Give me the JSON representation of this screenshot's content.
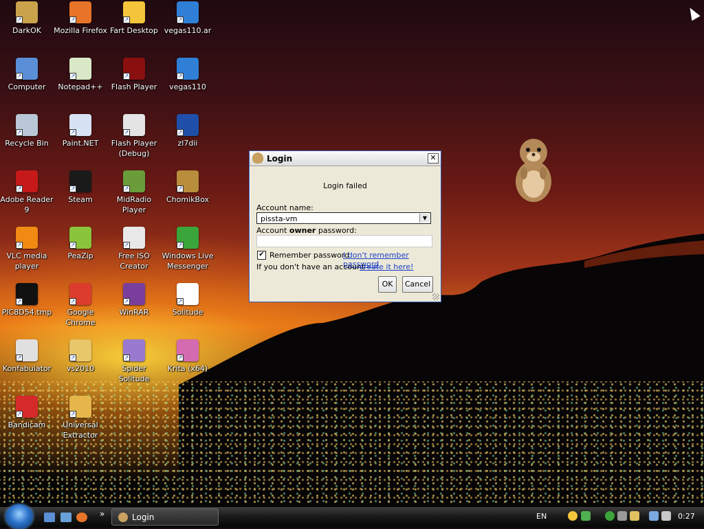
{
  "desktop": {
    "icons": [
      {
        "label": "DarkOK",
        "icon": "folder-zip-icon",
        "color": "#c9a24b"
      },
      {
        "label": "Mozilla Firefox",
        "icon": "firefox-icon",
        "color": "#e8742a"
      },
      {
        "label": "Fart Desktop",
        "icon": "smiley-icon",
        "color": "#f3c53a"
      },
      {
        "label": "vegas110.ar",
        "icon": "globe-icon",
        "color": "#2f7fd6"
      },
      {
        "label": "Computer",
        "icon": "computer-icon",
        "color": "#5a8fd8"
      },
      {
        "label": "Notepad++",
        "icon": "notepad-icon",
        "color": "#d9e8c7"
      },
      {
        "label": "Flash Player",
        "icon": "flash-icon",
        "color": "#8a1010"
      },
      {
        "label": "vegas110",
        "icon": "globe-icon",
        "color": "#2f7fd6"
      },
      {
        "label": "Recycle Bin",
        "icon": "recycle-bin-icon",
        "color": "#b9c7d6"
      },
      {
        "label": "Paint.NET",
        "icon": "paint-icon",
        "color": "#d7e3f5"
      },
      {
        "label": "Flash Player (Debug)",
        "icon": "flash-debug-icon",
        "color": "#e4e4e4"
      },
      {
        "label": "zl7dii",
        "icon": "flash-file-icon",
        "color": "#1f4fa8"
      },
      {
        "label": "Adobe Reader 9",
        "icon": "pdf-icon",
        "color": "#c61a1a"
      },
      {
        "label": "Steam",
        "icon": "steam-icon",
        "color": "#1a1a1a"
      },
      {
        "label": "MidRadio Player",
        "icon": "radio-icon",
        "color": "#6a9d3a"
      },
      {
        "label": "ChomikBox",
        "icon": "hamster-box-icon",
        "color": "#b88d3c"
      },
      {
        "label": "VLC media player",
        "icon": "vlc-cone-icon",
        "color": "#f08a12"
      },
      {
        "label": "PeaZip",
        "icon": "peazip-icon",
        "color": "#8ac43a"
      },
      {
        "label": "Free ISO Creator",
        "icon": "iso-icon",
        "color": "#e8e8e8"
      },
      {
        "label": "Windows Live Messenger",
        "icon": "messenger-icon",
        "color": "#3aa53a"
      },
      {
        "label": "PIC8D54.tmp",
        "icon": "terminal-icon",
        "color": "#111111"
      },
      {
        "label": "Google Chrome",
        "icon": "chrome-icon",
        "color": "#db3c2c"
      },
      {
        "label": "WinRAR",
        "icon": "winrar-icon",
        "color": "#7a3f9c"
      },
      {
        "label": "Solitude",
        "icon": "cards-icon",
        "color": "#ffffff"
      },
      {
        "label": "Konfabulator",
        "icon": "konfabulator-icon",
        "color": "#e0e0e0"
      },
      {
        "label": "vs2010",
        "icon": "folder-icon",
        "color": "#e8c66a"
      },
      {
        "label": "Spider Solitude",
        "icon": "spider-cards-icon",
        "color": "#9a7ad1"
      },
      {
        "label": "Krita (x64)",
        "icon": "krita-icon",
        "color": "#d46ab0"
      },
      {
        "label": "Bandicam",
        "icon": "bandicam-icon",
        "color": "#d42a2a"
      },
      {
        "label": "Universal Extractor",
        "icon": "box-icon",
        "color": "#e6b64a"
      }
    ]
  },
  "dialog": {
    "title": "Login",
    "status": "Login failed",
    "account_label": "Account name:",
    "account_value": "pissta-vm",
    "password_label_pre": "Account ",
    "password_label_bold": "owner",
    "password_label_post": " password:",
    "remember_label": "Remember password",
    "remember_checked": true,
    "forgot_link": "I don't remember password",
    "no_account_text": "If you don't have an account -",
    "create_link": "create it here!",
    "ok_label": "OK",
    "cancel_label": "Cancel",
    "close_glyph": "✕"
  },
  "taskbar": {
    "task_label": "Login",
    "more_glyph": "»",
    "language": "EN",
    "clock": "0:27"
  },
  "colors": {
    "accent": "#1a3fc8",
    "dialog_border": "#3a5bb5"
  }
}
